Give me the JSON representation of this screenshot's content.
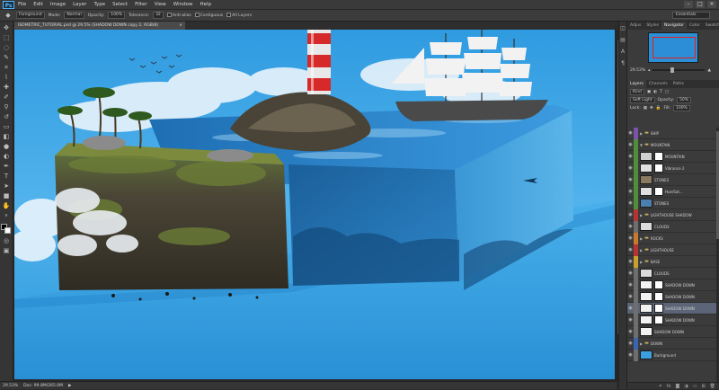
{
  "menubar": {
    "logo": "Ps",
    "items": [
      "File",
      "Edit",
      "Image",
      "Layer",
      "Type",
      "Select",
      "Filter",
      "View",
      "Window",
      "Help"
    ]
  },
  "options": {
    "tool_preset": "Foreground",
    "mode_label": "Mode:",
    "mode_value": "Normal",
    "opacity_label": "Opacity:",
    "opacity_value": "100%",
    "tolerance_label": "Tolerance:",
    "tolerance_value": "32",
    "antialias_label": "Anti-alias",
    "contiguous_label": "Contiguous",
    "all_layers_label": "All Layers",
    "workspace": "Essentials"
  },
  "document": {
    "tab_title": "ISOMETRIC_TUTORIAL.psd @ 29.5% (SHADOW DOWN copy 2, RGB/8)",
    "close": "×"
  },
  "status": {
    "zoom": "29.53%",
    "doc_size": "Doc: 99.8M/265.0M"
  },
  "panel": {
    "top_tabs": [
      "Adjus",
      "Styles",
      "Navigator",
      "Color",
      "Swatch"
    ],
    "active_top_tab": "Navigator",
    "nav_zoom": "29.53%",
    "layer_tabs": [
      "Layers",
      "Channels",
      "Paths"
    ],
    "active_layer_tab": "Layers",
    "kind_label": "Kind",
    "blend_mode": "Soft Light",
    "opacity_label": "Opacity:",
    "opacity_value": "50%",
    "lock_label": "Lock:",
    "fill_label": "Fill:",
    "fill_value": "100%",
    "layers": [
      {
        "name": "SHIP",
        "type": "folder",
        "color": "#7a52a8",
        "open": false
      },
      {
        "name": "MOUNTAIN",
        "type": "folder",
        "color": "#4f8f3a",
        "open": true
      },
      {
        "name": "MOUNTAIN",
        "type": "layer",
        "color": "#4f8f3a",
        "thumb": "#cfcfcf",
        "mask": true
      },
      {
        "name": "Vibrance 2",
        "type": "adjust",
        "color": "#4f8f3a",
        "thumb": "#e0e0e0",
        "mask": true
      },
      {
        "name": "STONES",
        "type": "layer",
        "color": "#4f8f3a",
        "thumb": "#8a7a60",
        "mask": false
      },
      {
        "name": "Hue/Sat...",
        "type": "adjust",
        "color": "#4f8f3a",
        "thumb": "#e0e0e0",
        "mask": true
      },
      {
        "name": "STONES",
        "type": "layer",
        "color": "#4f8f3a",
        "thumb": "#4a7fb0",
        "mask": false
      },
      {
        "name": "LIGHTHOUSE SHADOW",
        "type": "folder",
        "color": "#b83333",
        "open": false
      },
      {
        "name": "CLOUDS",
        "type": "layer",
        "color": "#6e6e6e",
        "thumb": "#dcdcdc",
        "mask": false
      },
      {
        "name": "ROCKS",
        "type": "folder",
        "color": "#c87a2a",
        "open": false
      },
      {
        "name": "LIGHTHOUSE",
        "type": "folder",
        "color": "#b83333",
        "open": false
      },
      {
        "name": "BASE",
        "type": "folder",
        "color": "#c8a030",
        "open": false
      },
      {
        "name": "CLOUDS",
        "type": "layer",
        "color": "#6e6e6e",
        "thumb": "#dcdcdc",
        "mask": false
      },
      {
        "name": "SHADOW DOWN",
        "type": "layer",
        "color": "#6e6e6e",
        "thumb": "#f2f2f2",
        "mask": true
      },
      {
        "name": "SHADOW DOWN",
        "type": "layer",
        "color": "#6e6e6e",
        "thumb": "#f2f2f2",
        "mask": true
      },
      {
        "name": "SHADOW DOWN",
        "type": "layer",
        "color": "#6e6e6e",
        "thumb": "#f2f2f2",
        "mask": true,
        "selected": true
      },
      {
        "name": "SHADOW DOWN",
        "type": "layer",
        "color": "#6e6e6e",
        "thumb": "#f2f2f2",
        "mask": true
      },
      {
        "name": "SHADOW DOWN",
        "type": "layer",
        "color": "#6e6e6e",
        "thumb": "#f2f2f2",
        "mask": false
      },
      {
        "name": "DOWN",
        "type": "folder",
        "color": "#3a66b0",
        "open": false
      },
      {
        "name": "Background",
        "type": "layer",
        "color": "#6e6e6e",
        "thumb": "#3aa0e0",
        "mask": false
      }
    ]
  }
}
